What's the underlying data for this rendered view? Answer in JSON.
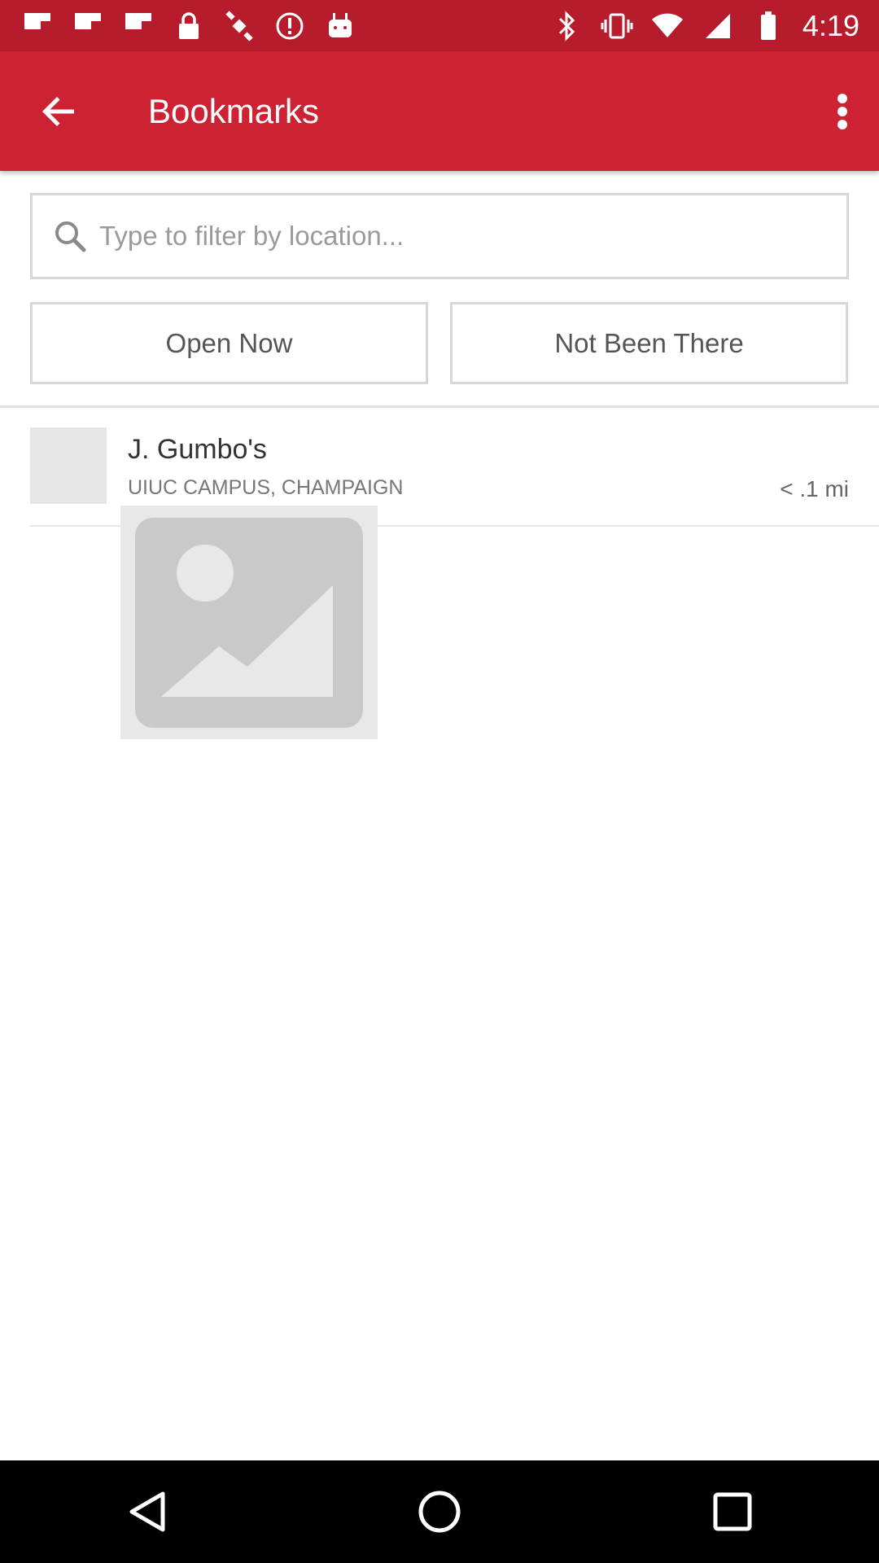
{
  "status_bar": {
    "time": "4:19",
    "left_icons": [
      "flipboard-icon",
      "flipboard-icon",
      "flipboard-icon",
      "lock-icon",
      "fake-gps-icon",
      "alert-icon",
      "android-icon"
    ],
    "right_icons": [
      "bluetooth-icon",
      "vibrate-icon",
      "wifi-icon",
      "signal-icon",
      "battery-icon"
    ]
  },
  "app_bar": {
    "title": "Bookmarks",
    "color": "#cc2233"
  },
  "search": {
    "placeholder": "Type to filter by location..."
  },
  "filters": {
    "open_now": "Open Now",
    "not_been_there": "Not Been There"
  },
  "list": {
    "items": [
      {
        "name": "J. Gumbo's",
        "location": "UIUC CAMPUS, CHAMPAIGN",
        "distance": "< .1 mi"
      }
    ]
  }
}
